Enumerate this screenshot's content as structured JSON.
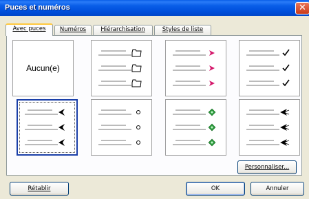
{
  "window": {
    "title": "Puces et numéros",
    "close_glyph": "✕"
  },
  "tabs": [
    {
      "label": "Avec puces",
      "active": true
    },
    {
      "label": "Numéros",
      "active": false
    },
    {
      "label": "Hiérarchisation",
      "active": false
    },
    {
      "label": "Styles de liste",
      "active": false
    }
  ],
  "grid": {
    "cells": [
      {
        "kind": "none",
        "label": "Aucun(e)"
      },
      {
        "kind": "bullets",
        "icon": "folder-icon"
      },
      {
        "kind": "bullets",
        "icon": "arrowhead-icon",
        "color": "#d4186b"
      },
      {
        "kind": "bullets",
        "icon": "checkmark-icon"
      },
      {
        "kind": "bullets",
        "icon": "arrowhead-left-icon",
        "selected": true
      },
      {
        "kind": "bullets",
        "icon": "circle-icon"
      },
      {
        "kind": "bullets",
        "icon": "diamond-icon",
        "color": "#2a9b3a"
      },
      {
        "kind": "bullets",
        "icon": "arrow-icon"
      }
    ]
  },
  "buttons": {
    "customize": "Personnaliser...",
    "reset": "Rétablir",
    "ok": "OK",
    "cancel": "Annuler"
  }
}
